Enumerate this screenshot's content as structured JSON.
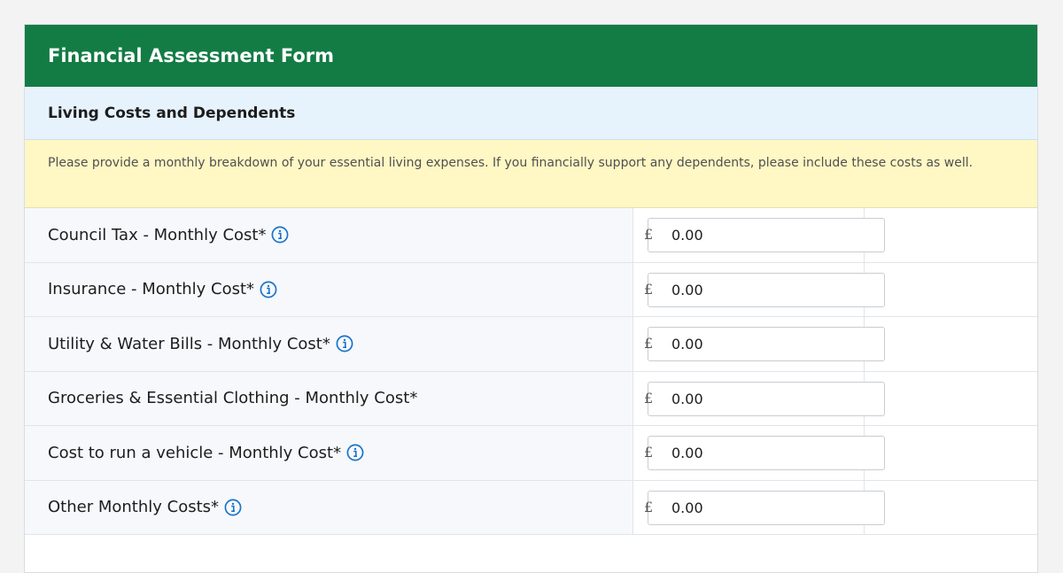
{
  "form": {
    "title": "Financial Assessment Form"
  },
  "section": {
    "title": "Living Costs and Dependents",
    "notice": "Please provide a monthly breakdown of your essential living expenses. If you financially support any dependents, please include these costs as well."
  },
  "rows": [
    {
      "label": "Council Tax - Monthly Cost*",
      "has_info": true,
      "currency": "£",
      "value": "0.00"
    },
    {
      "label": "Insurance - Monthly Cost*",
      "has_info": true,
      "currency": "£",
      "value": "0.00"
    },
    {
      "label": "Utility & Water Bills - Monthly Cost*",
      "has_info": true,
      "currency": "£",
      "value": "0.00"
    },
    {
      "label": "Groceries & Essential Clothing - Monthly Cost*",
      "has_info": false,
      "currency": "£",
      "value": "0.00"
    },
    {
      "label": "Cost to run a vehicle - Monthly Cost*",
      "has_info": true,
      "currency": "£",
      "value": "0.00"
    },
    {
      "label": "Other Monthly Costs*",
      "has_info": true,
      "currency": "£",
      "value": "0.00"
    }
  ],
  "icons": {
    "info": "info-icon"
  },
  "colors": {
    "header_bg": "#137c44",
    "section_bg": "#e6f3fd",
    "notice_bg": "#fff7c4",
    "info_icon": "#1a73c8"
  }
}
